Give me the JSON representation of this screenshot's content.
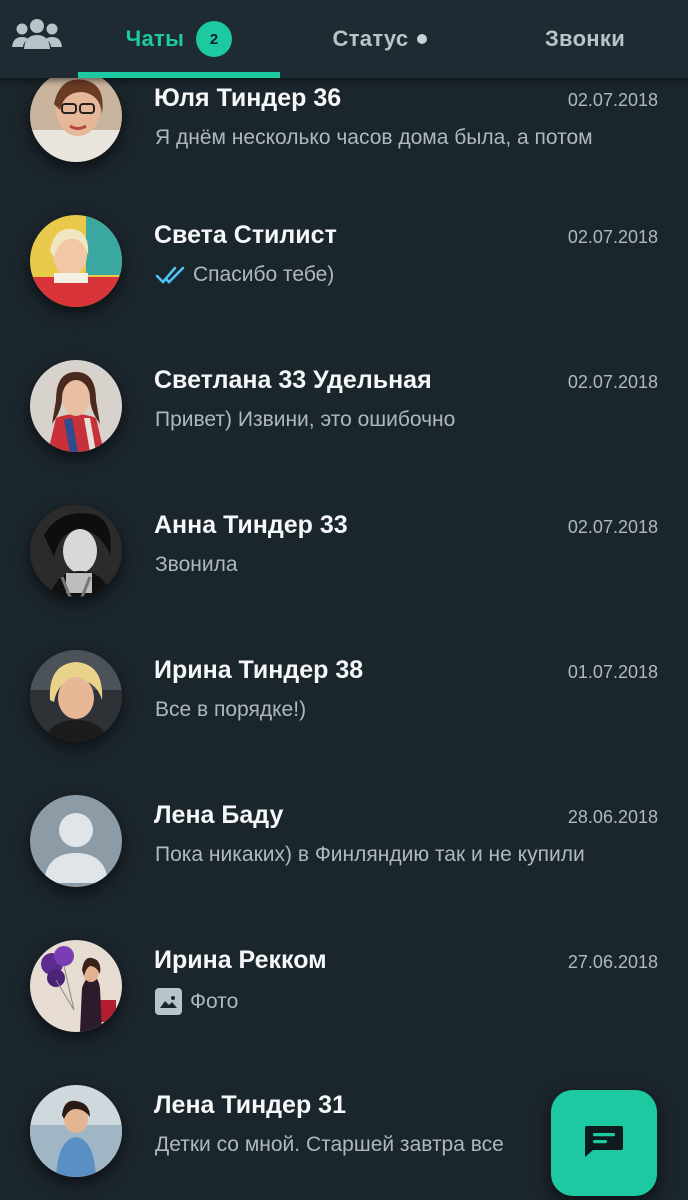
{
  "tabs": {
    "people_icon": "people-icon",
    "chats_label": "Чаты",
    "chats_badge": "2",
    "status_label": "Статус",
    "calls_label": "Звонки"
  },
  "chats": [
    {
      "name": "Юля Тиндер 36",
      "date": "02.07.2018",
      "preview": "Я днём несколько часов дома была, а потом",
      "avatar": "photo"
    },
    {
      "name": "Света Стилист",
      "date": "02.07.2018",
      "preview": "Спасибо тебе)",
      "avatar": "photo",
      "read_ticks": true
    },
    {
      "name": "Светлана 33 Удельная",
      "date": "02.07.2018",
      "preview": "Привет) Извини, это ошибочно",
      "avatar": "photo"
    },
    {
      "name": "Анна Тиндер 33",
      "date": "02.07.2018",
      "preview": "Звонила",
      "avatar": "photo"
    },
    {
      "name": "Ирина Тиндер 38",
      "date": "01.07.2018",
      "preview": "Все в порядке!)",
      "avatar": "photo"
    },
    {
      "name": "Лена Баду",
      "date": "28.06.2018",
      "preview": "Пока никаких) в Финляндию так и не купили",
      "avatar": "default"
    },
    {
      "name": "Ирина Рекком",
      "date": "27.06.2018",
      "preview": "Фото",
      "avatar": "photo",
      "photo_icon": true
    },
    {
      "name": "Лена Тиндер 31",
      "date": "",
      "preview": "Детки со мной. Старшей завтра все",
      "avatar": "photo"
    }
  ],
  "fab": {
    "icon": "new-chat-icon"
  },
  "colors": {
    "accent": "#1dc9a0",
    "background": "#1b252c",
    "tab_bar": "#1f2b33",
    "secondary_text": "#aeb9bf",
    "ticks": "#4fc3f7"
  }
}
